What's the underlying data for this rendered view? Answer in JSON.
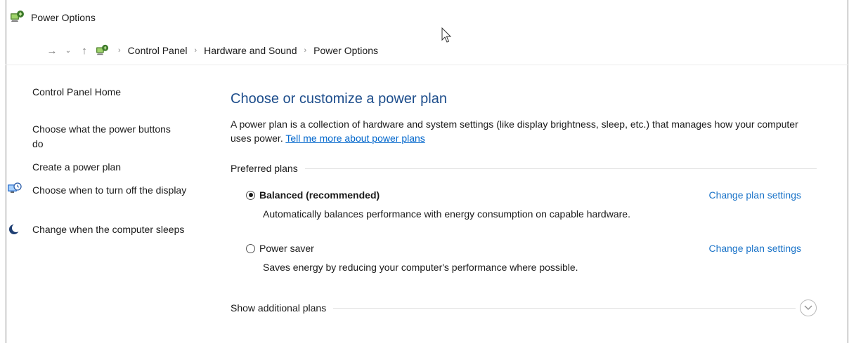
{
  "window": {
    "title": "Power Options"
  },
  "address_bar": {
    "breadcrumbs": [
      "Control Panel",
      "Hardware and Sound",
      "Power Options"
    ]
  },
  "sidebar": {
    "items": [
      {
        "label": "Control Panel Home"
      },
      {
        "label": "Choose what the power buttons do"
      },
      {
        "label": "Create a power plan"
      },
      {
        "label": "Choose when to turn off the display",
        "icon": "display-clock-icon"
      },
      {
        "label": "Change when the computer sleeps",
        "icon": "moon-icon"
      }
    ]
  },
  "main": {
    "heading": "Choose or customize a power plan",
    "description": "A power plan is a collection of hardware and system settings (like display brightness, sleep, etc.) that manages how your computer uses power.",
    "help_link": "Tell me more about power plans",
    "preferred_plans_label": "Preferred plans",
    "plans": [
      {
        "name": "Balanced (recommended)",
        "selected": true,
        "description": "Automatically balances performance with energy consumption on capable hardware.",
        "link": "Change plan settings"
      },
      {
        "name": "Power saver",
        "selected": false,
        "description": "Saves energy by reducing your computer's performance where possible.",
        "link": "Change plan settings"
      }
    ],
    "additional_plans_label": "Show additional plans"
  },
  "colors": {
    "heading": "#1e4e8c",
    "link": "#1a73c8",
    "underline_link": "#0066cc"
  }
}
